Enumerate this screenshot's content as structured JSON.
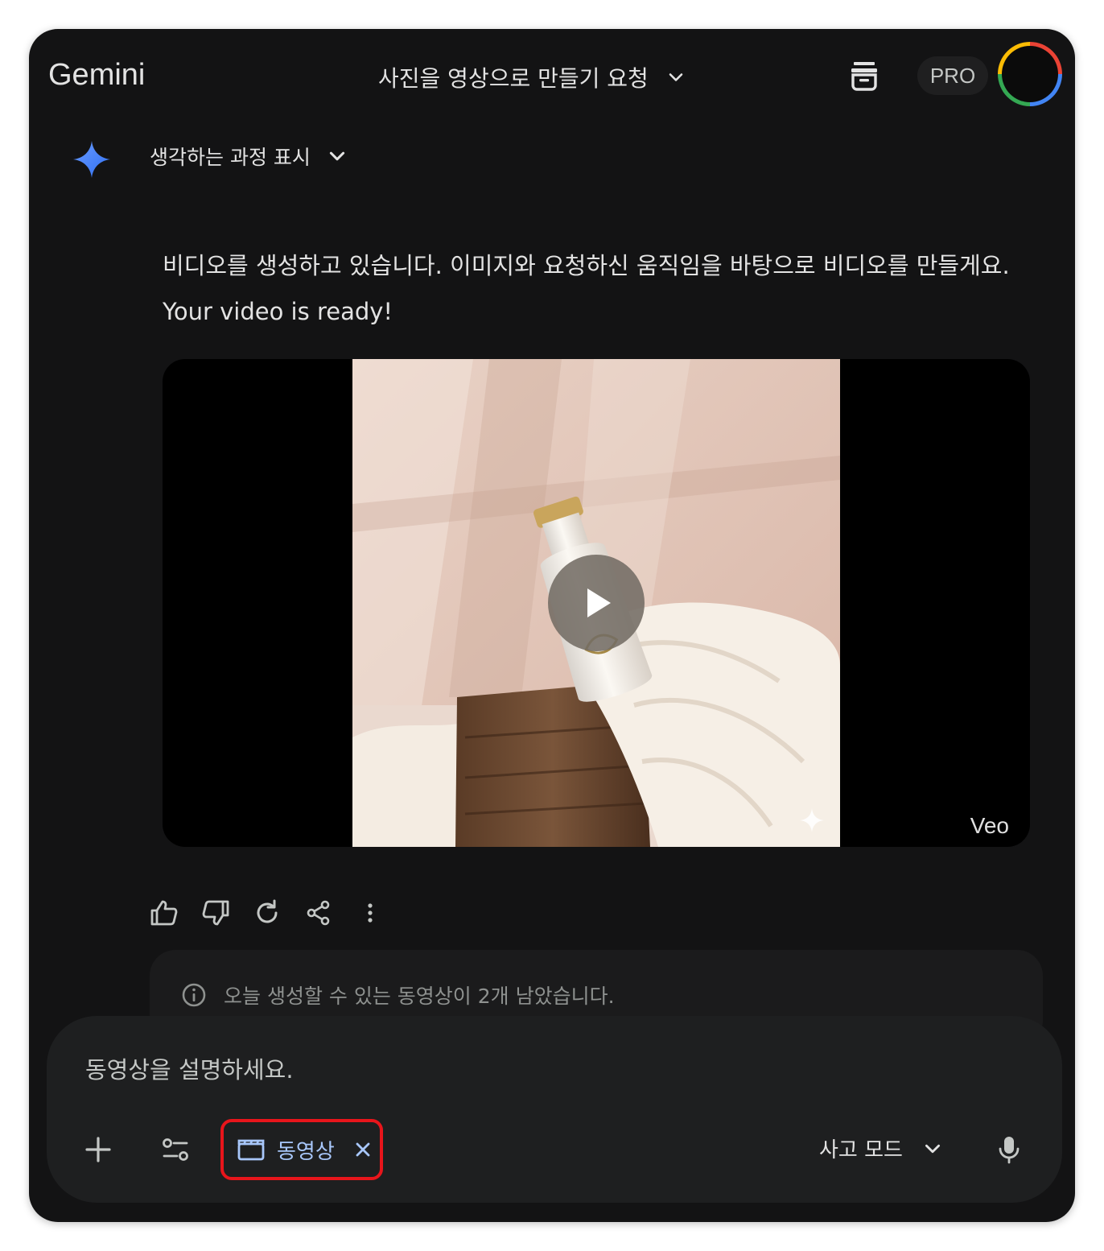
{
  "header": {
    "brand": "Gemini",
    "conversation_title": "사진을 영상으로 만들기 요청",
    "plan_badge": "PRO"
  },
  "thinking": {
    "label": "생각하는 과정 표시"
  },
  "message": {
    "text": "비디오를 생성하고 있습니다. 이미지와 요청하신 움직임을 바탕으로 비디오를 만들게요. Your video is ready!",
    "video": {
      "watermark": "Veo"
    }
  },
  "actions": {
    "items": [
      "thumbs-up-icon",
      "thumbs-down-icon",
      "redo-icon",
      "share-icon",
      "more-vert-icon"
    ]
  },
  "notice": {
    "text": "오늘 생성할 수 있는 동영상이 2개 남았습니다."
  },
  "composer": {
    "placeholder": "동영상을 설명하세요.",
    "chip_label": "동영상",
    "mode_label": "사고 모드"
  },
  "colors": {
    "background": "#131314",
    "composer": "#1e1f20",
    "chip_text": "#a8c7fa",
    "highlight_border": "#e8151b",
    "gemini_blue": "#4285f4"
  }
}
